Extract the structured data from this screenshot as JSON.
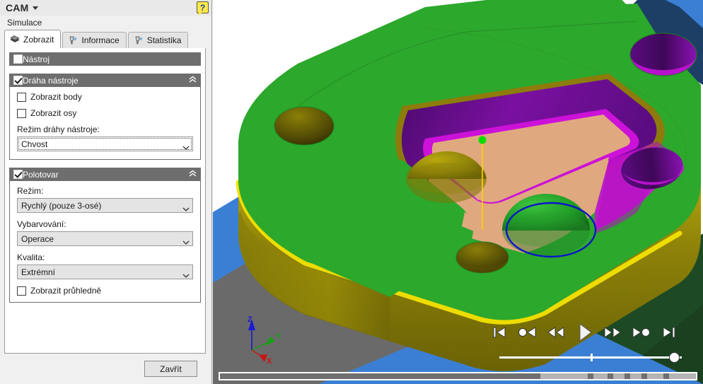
{
  "window": {
    "app_title": "CAM",
    "subtitle": "Simulace",
    "help_label": "?",
    "help_icon": "help-question-icon",
    "title_caret_icon": "chevron-down-icon"
  },
  "tabs": [
    {
      "label": "Zobrazit",
      "icon": "display-layers-icon",
      "active": true
    },
    {
      "label": "Informace",
      "icon": "tool-info-icon",
      "active": false
    },
    {
      "label": "Statistika",
      "icon": "tool-stats-icon",
      "active": false
    }
  ],
  "sections": {
    "tool": {
      "title": "Nástroj",
      "checked": false,
      "collapsible": false
    },
    "toolpath": {
      "title": "Dráha nástroje",
      "checked": true,
      "collapse_icon": "chevron-double-up-icon",
      "checkboxes": [
        {
          "label": "Zobrazit body",
          "checked": false
        },
        {
          "label": "Zobrazit osy",
          "checked": false
        }
      ],
      "mode": {
        "label": "Režim dráhy nástroje:",
        "value": "Chvost",
        "focused": true
      }
    },
    "stock": {
      "title": "Polotovar",
      "checked": true,
      "collapse_icon": "chevron-double-up-icon",
      "fields": [
        {
          "label": "Režim:",
          "value": "Rychlý (pouze 3-osé)"
        },
        {
          "label": "Vybarvování:",
          "value": "Operace"
        },
        {
          "label": "Kvalita:",
          "value": "Extrémní"
        }
      ],
      "transparent": {
        "label": "Zobrazit průhledně",
        "checked": false
      }
    }
  },
  "footer": {
    "close_label": "Zavřít"
  },
  "viewport": {
    "playback": [
      {
        "name": "skip-to-start-button",
        "icon": "skip-start-icon"
      },
      {
        "name": "step-back-point-button",
        "icon": "step-back-point-icon"
      },
      {
        "name": "rewind-button",
        "icon": "rewind-icon"
      },
      {
        "name": "play-button",
        "icon": "play-icon"
      },
      {
        "name": "fast-forward-button",
        "icon": "fast-forward-icon"
      },
      {
        "name": "step-forward-point-button",
        "icon": "step-forward-point-icon"
      },
      {
        "name": "skip-to-end-button",
        "icon": "skip-end-icon"
      }
    ],
    "slider": {
      "value_percent": 93,
      "tick_percent": 50
    },
    "progress": {
      "filled_percent": 68
    },
    "axis_triad": {
      "x": "X",
      "y": "Y",
      "z": "Z"
    },
    "colors": {
      "stock_top": "#2ca82c",
      "stock_side": "#7f7f0a",
      "pocket_wall": "#6b0f8e",
      "pocket_floor": "#e0a87e",
      "highlight_magenta": "#cc11d8",
      "rim_gold": "#8d7b0b",
      "edge_yellow": "#f2e200",
      "table_blue": "#3b7fd4",
      "table_dark_blue": "#1d3f66",
      "table_gray": "#6a6a6a",
      "floor_dark_green": "#1d4a25",
      "toolpath_blue": "#0a14c8",
      "tool_point_green": "#00e000",
      "tool_axis_yellow": "#ffd400"
    }
  }
}
